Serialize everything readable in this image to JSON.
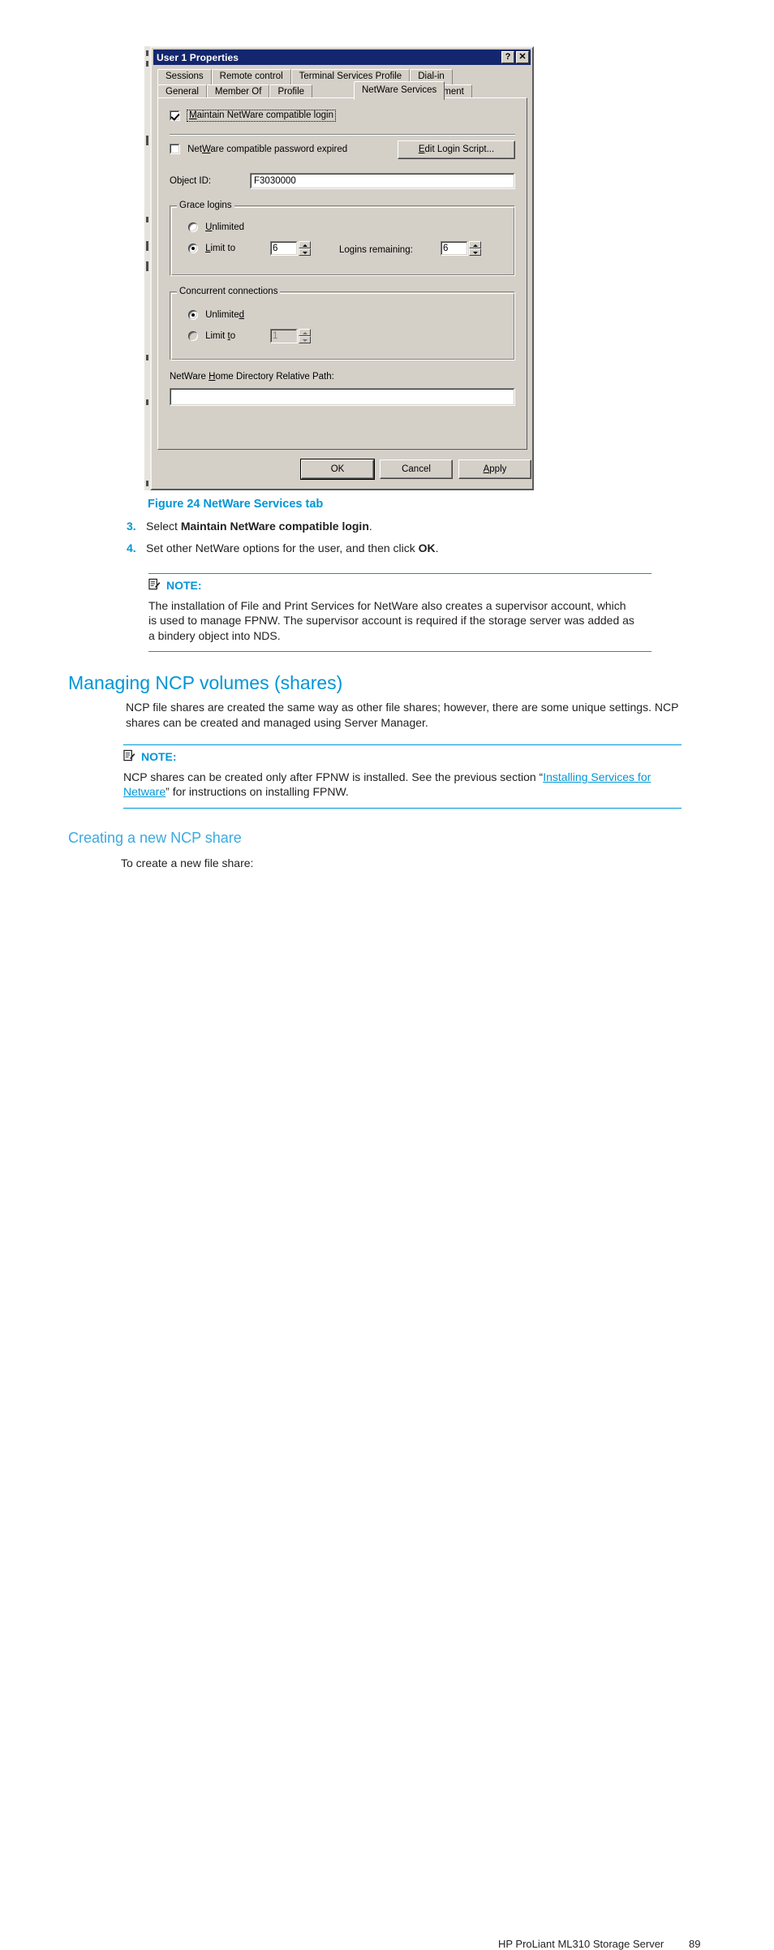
{
  "dialog": {
    "title": "User 1 Properties",
    "help_button": "?",
    "close_button": "✕",
    "tabs_row1": [
      "Sessions",
      "Remote control",
      "Terminal Services Profile",
      "Dial-in"
    ],
    "tabs_row2": [
      "General",
      "Member Of",
      "Profile",
      "NetWare Services",
      "Environment"
    ],
    "selected_tab": "NetWare Services",
    "maintain_login": {
      "label": "Maintain NetWare compatible login",
      "checked": "checked"
    },
    "password_expired": {
      "label": "NetWare compatible password expired",
      "checked": "unchecked"
    },
    "edit_login_script_button": "Edit Login Script...",
    "object_id": {
      "label": "Object ID:",
      "value": "F3030000"
    },
    "grace_logins": {
      "caption": "Grace logins",
      "unlimited_label": "Unlimited",
      "limit_to_label": "Limit to",
      "limit_value": "6",
      "logins_remaining_label": "Logins remaining:",
      "logins_remaining_value": "6",
      "selected": "Limit to"
    },
    "concurrent_connections": {
      "caption": "Concurrent connections",
      "unlimited_label": "Unlimited",
      "limit_to_label": "Limit to",
      "limit_value": "1",
      "selected": "Unlimited"
    },
    "home_directory": {
      "label": "NetWare Home Directory Relative Path:",
      "value": ""
    },
    "buttons": {
      "ok": "OK",
      "cancel": "Cancel",
      "apply": "Apply"
    }
  },
  "document": {
    "figure_caption": "Figure 24 NetWare Services tab",
    "steps": [
      {
        "num": "3.",
        "text_before": "Select ",
        "bold": "Maintain NetWare compatible login",
        "text_after": "."
      },
      {
        "num": "4.",
        "text_before": "Set other NetWare options for the user, and then click ",
        "bold": "OK",
        "text_after": "."
      }
    ],
    "note1": {
      "label": "NOTE:",
      "body": "The installation of File and Print Services for NetWare also creates a supervisor account, which is used to manage FPNW. The supervisor account is required if the storage server was added as a bindery object into NDS."
    },
    "heading1": "Managing NCP volumes (shares)",
    "paragraph1": "NCP file shares are created the same way as other file shares; however, there are some unique settings. NCP shares can be created and managed using Server Manager.",
    "note2": {
      "label": "NOTE:",
      "body_before": "NCP shares can be created only after FPNW is installed. See the previous section “",
      "link": "Installing Services for Netware",
      "body_after": "” for instructions on installing FPNW."
    },
    "heading2": "Creating a new NCP share",
    "paragraph2": "To create a new file share:",
    "footer_title": "HP ProLiant ML310 Storage Server",
    "footer_page": "89"
  },
  "colors": {
    "hp_blue": "#0096d6",
    "heading_blue": "#3aa9e0",
    "dialog_face": "#d4d0c8",
    "titlebar": "#14276e"
  }
}
